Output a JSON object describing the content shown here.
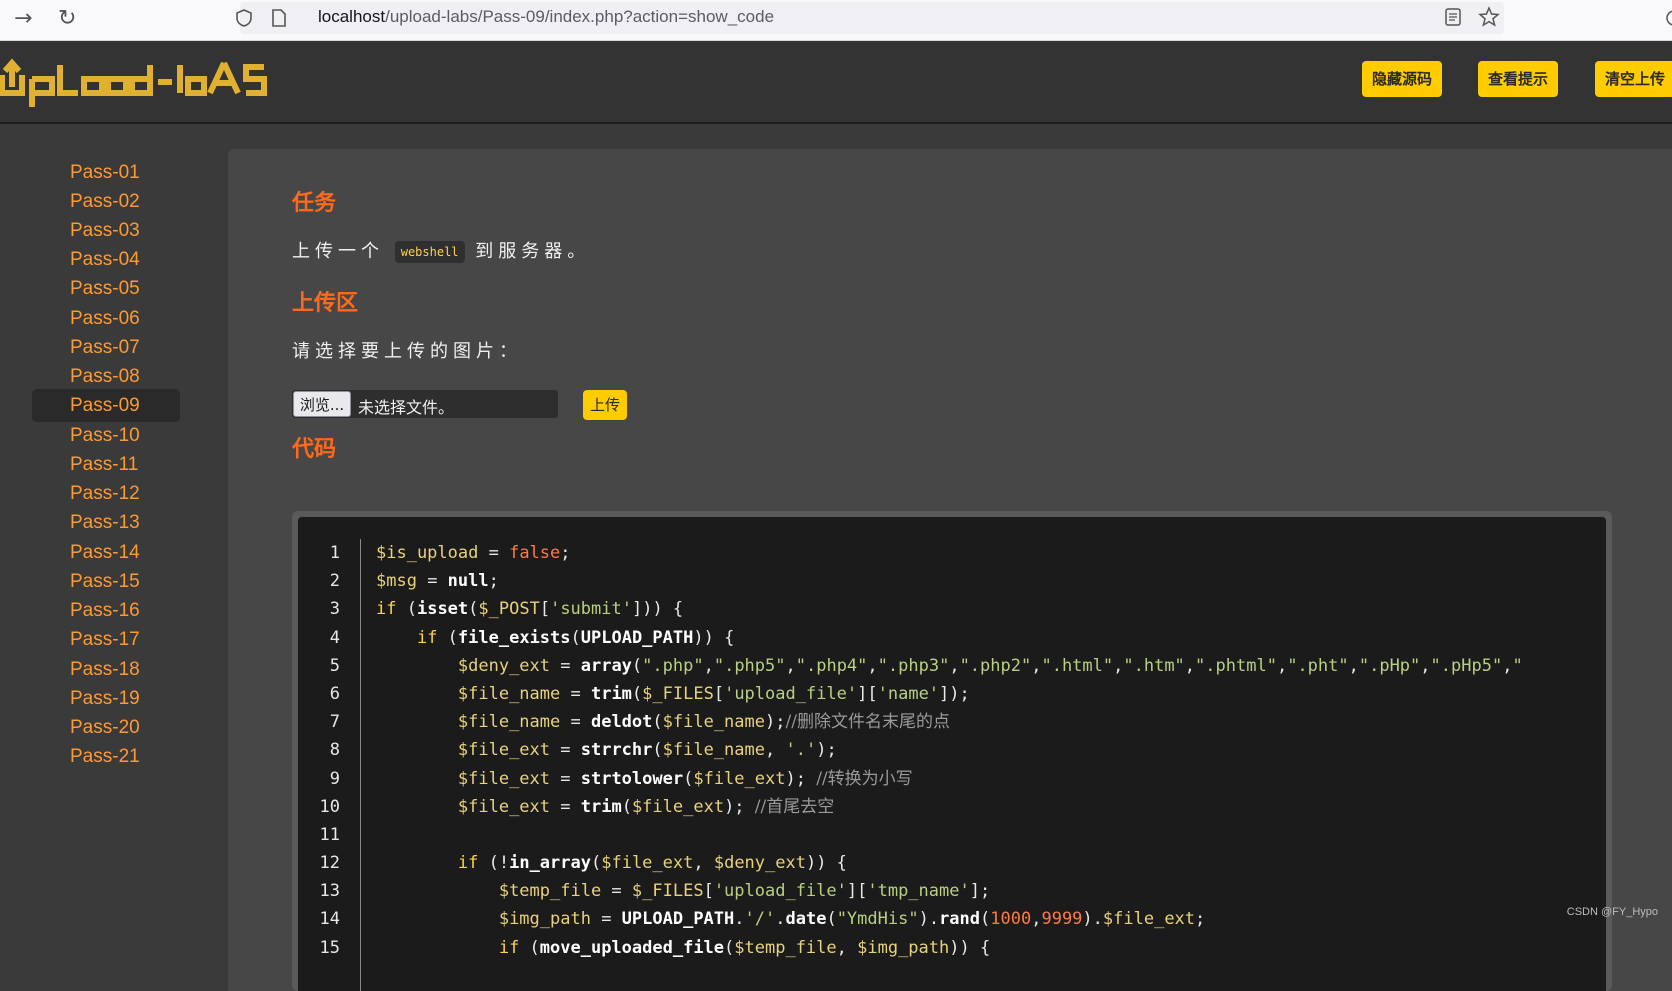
{
  "browser": {
    "url_host": "localhost",
    "url_path": "/upload-labs/Pass-09/index.php?action=show_code"
  },
  "header": {
    "logo_text": "UpLoad-labS",
    "buttons": [
      "隐藏源码",
      "查看提示",
      "清空上传"
    ]
  },
  "sidebar": {
    "items": [
      "Pass-01",
      "Pass-02",
      "Pass-03",
      "Pass-04",
      "Pass-05",
      "Pass-06",
      "Pass-07",
      "Pass-08",
      "Pass-09",
      "Pass-10",
      "Pass-11",
      "Pass-12",
      "Pass-13",
      "Pass-14",
      "Pass-15",
      "Pass-16",
      "Pass-17",
      "Pass-18",
      "Pass-19",
      "Pass-20",
      "Pass-21"
    ],
    "active": "Pass-09"
  },
  "main": {
    "task_heading": "任务",
    "task_prefix": "上传一个",
    "task_code": "webshell",
    "task_suffix": "到服务器。",
    "upload_heading": "上传区",
    "upload_prompt": "请选择要上传的图片：",
    "browse_label": "浏览...",
    "file_status": "未选择文件。",
    "upload_label": "上传",
    "code_heading": "代码"
  },
  "code": {
    "line_numbers": [
      "1",
      "2",
      "3",
      "4",
      "5",
      "6",
      "7",
      "8",
      "9",
      "10",
      "11",
      "12",
      "13",
      "14",
      "15"
    ]
  },
  "watermark": "CSDN @FY_Hypo",
  "colors": {
    "accent_button": "#ffcc00",
    "heading": "#ff6a1a",
    "sidebar_link": "#ff9a33"
  }
}
